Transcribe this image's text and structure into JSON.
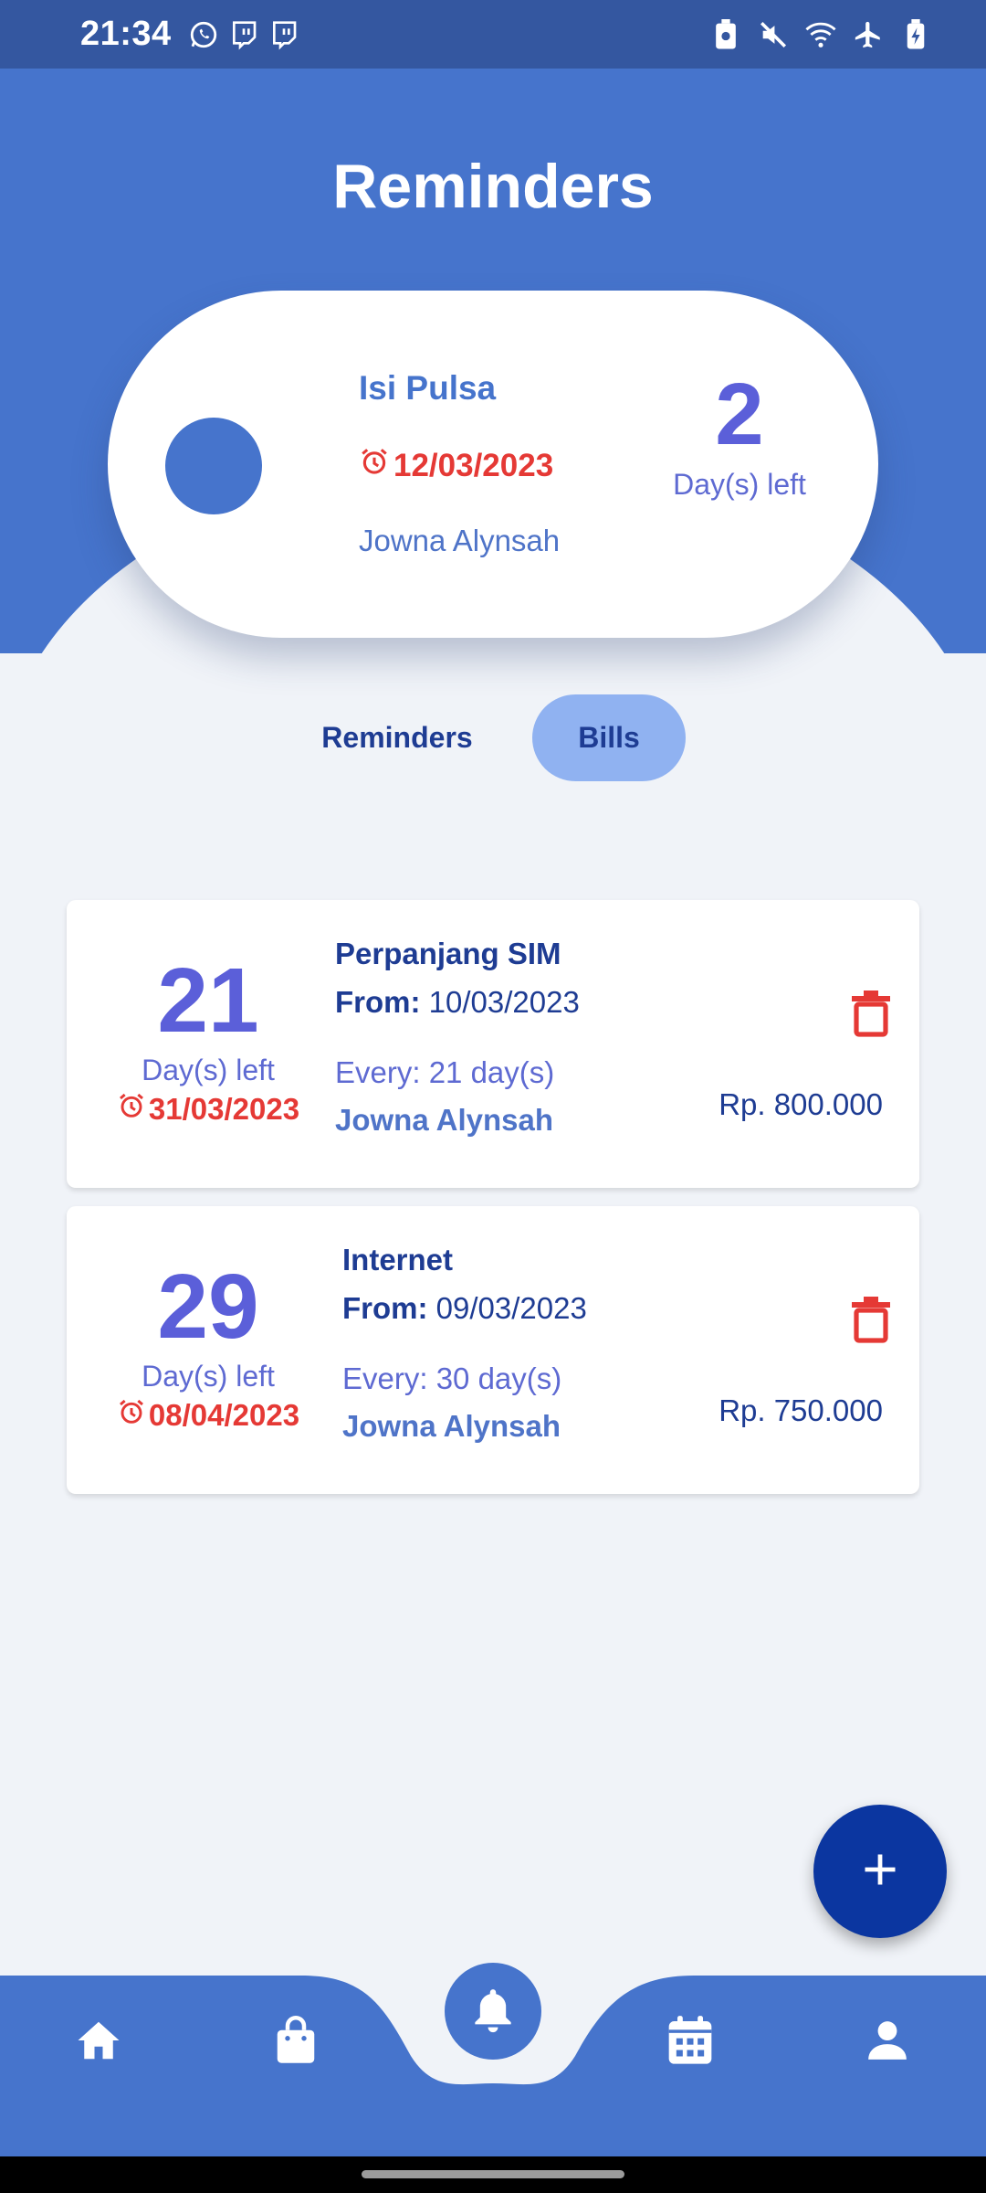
{
  "status_bar": {
    "time": "21:34",
    "left_icons": [
      "whatsapp-icon",
      "twitch-icon",
      "twitch-icon"
    ],
    "right_icons": [
      "battery-saver-icon",
      "mute-icon",
      "wifi-icon",
      "airplane-icon",
      "battery-charging-icon"
    ]
  },
  "header": {
    "title": "Reminders"
  },
  "featured": {
    "title": "Isi Pulsa",
    "date": "12/03/2023",
    "person": "Jowna Alynsah",
    "days_left_value": "2",
    "days_left_label": "Day(s) left"
  },
  "tabs": [
    {
      "label": "Reminders",
      "active": false
    },
    {
      "label": "Bills",
      "active": true
    }
  ],
  "bills": [
    {
      "days": "21",
      "days_label": "Day(s) left",
      "due_date": "31/03/2023",
      "title": "Perpanjang SIM",
      "from_label": "From:",
      "from_date": "10/03/2023",
      "every": "Every: 21 day(s)",
      "person": "Jowna Alynsah",
      "amount": "Rp. 800.000"
    },
    {
      "days": "29",
      "days_label": "Day(s) left",
      "due_date": "08/04/2023",
      "title": "Internet",
      "from_label": "From:",
      "from_date": "09/03/2023",
      "every": "Every: 30 day(s)",
      "person": "Jowna Alynsah",
      "amount": "Rp. 750.000"
    }
  ],
  "fab": {
    "icon": "plus-icon"
  },
  "bottom_nav": {
    "items": [
      "home-icon",
      "shopping-bag-icon",
      "bell-icon",
      "calendar-icon",
      "profile-icon"
    ],
    "active": "bell-icon"
  },
  "colors": {
    "primary": "#4674cc",
    "status_bar": "#3457a0",
    "accent_number": "#5b5fd9",
    "danger": "#e53935",
    "dark_text": "#1e3c93",
    "tab_active": "#90b2f1",
    "fab": "#0b36a0",
    "background": "#f0f3f8"
  }
}
